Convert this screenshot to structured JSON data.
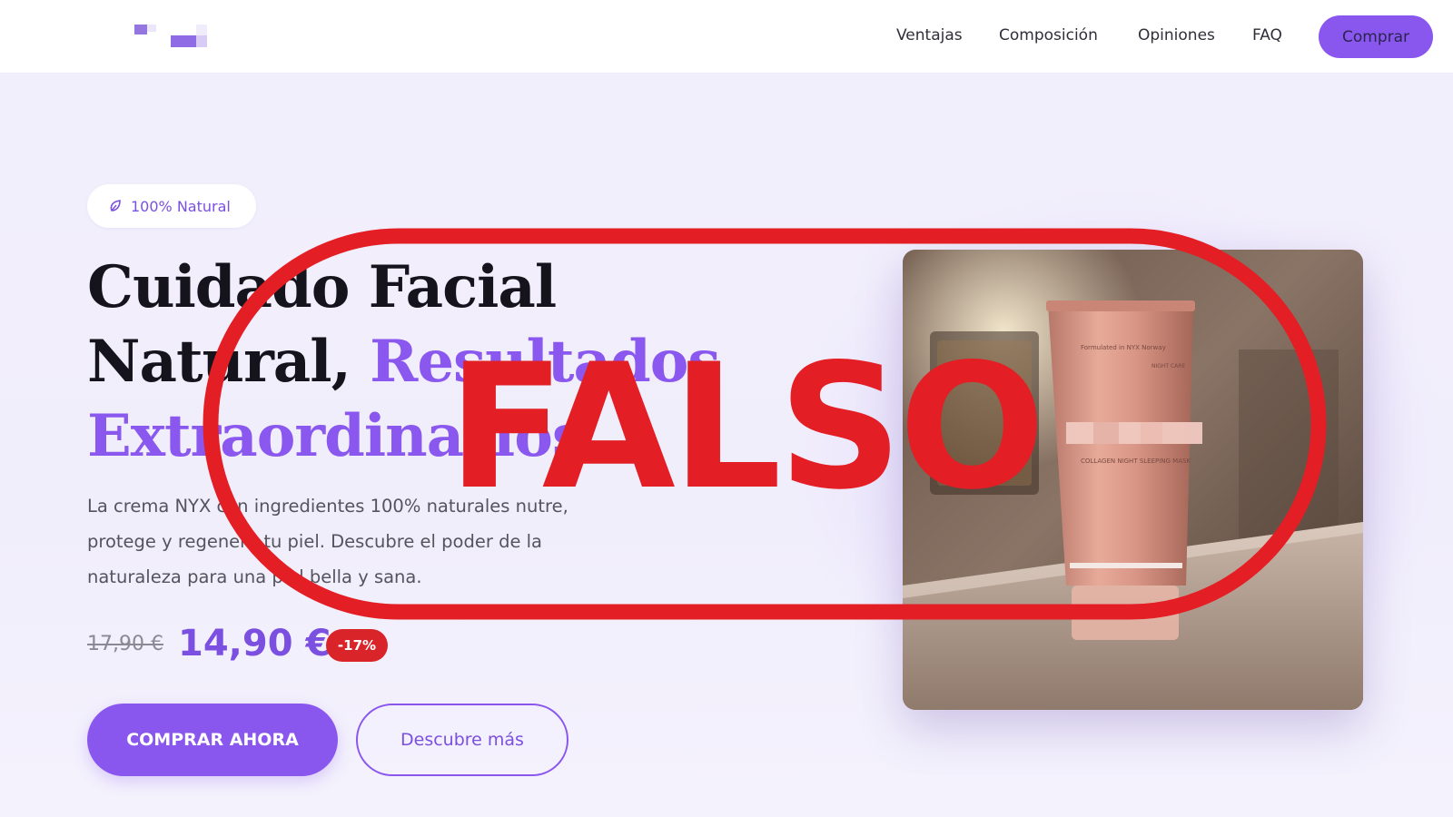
{
  "header": {
    "nav": [
      "Ventajas",
      "Composición",
      "Opiniones",
      "FAQ"
    ],
    "buy_label": "Comprar",
    "logo_icon": "pixelated-logo-icon"
  },
  "hero": {
    "badge": {
      "icon": "leaf-icon",
      "label": "100% Natural"
    },
    "title_line1": "Cuidado Facial",
    "title_line2_dark": "Natural, ",
    "title_line2_accent": "Resultados",
    "title_line3_accent": "Extraordinarios",
    "description": "La crema NYX con ingredientes 100% naturales nutre, protege y regenera tu piel. Descubre el poder de la naturaleza para una piel bella y sana.",
    "old_price": "17,90 €",
    "price": "14,90 €",
    "discount": "-17%",
    "cta_primary": "COMPRAR AHORA",
    "cta_secondary": "Descubre más"
  },
  "product": {
    "image": "product-tube-photo",
    "tube_text_top": "Formulated in NYX Norway",
    "tube_brand": "NIGHT CARE",
    "tube_name": "COLLAGEN NIGHT SLEEPING MASK"
  },
  "stamp": {
    "label": "FALSO",
    "color": "#e31e24"
  },
  "colors": {
    "accent": "#8a57ee",
    "accent_text": "#7b4fe0",
    "discount": "#d9252a",
    "title": "#15141c"
  }
}
